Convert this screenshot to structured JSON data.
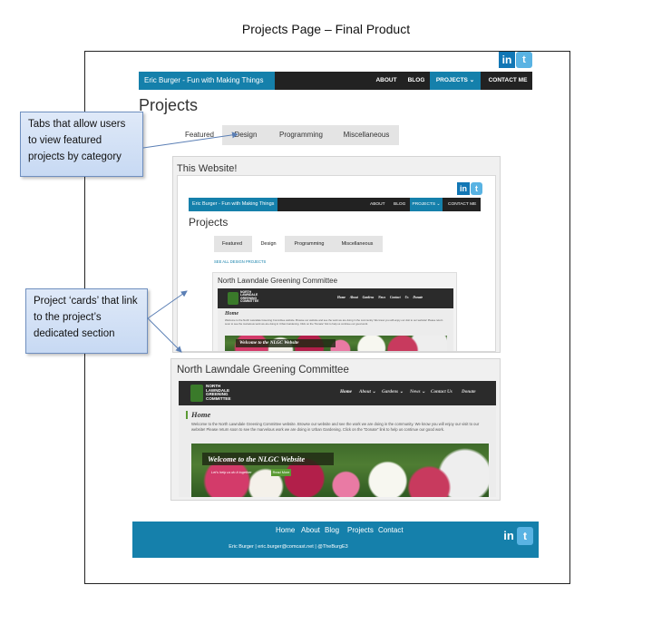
{
  "doc_title": "Projects Page – Final Product",
  "site": {
    "brand": "Eric Burger - Fun with Making Things",
    "nav": [
      "ABOUT",
      "BLOG",
      "PROJECTS",
      "CONTACT ME"
    ],
    "nav_active": "PROJECTS",
    "page_heading": "Projects",
    "tabs": [
      "Featured",
      "Design",
      "Programming",
      "Miscellaneous"
    ],
    "social": {
      "linkedin": "in",
      "twitter": "t"
    }
  },
  "card1": {
    "title": "This Website!",
    "inner": {
      "brand": "Eric Burger - Fun with Making Things",
      "nav": [
        "ABOUT",
        "BLOG",
        "PROJECTS ⌄",
        "CONTACT ME"
      ],
      "heading": "Projects",
      "tabs": [
        "Featured",
        "Design",
        "Programming",
        "Miscellaneous"
      ],
      "see_all": "SEE ALL DESIGN PROJECTS",
      "subcard_title": "North Lawndale Greening Committee"
    }
  },
  "card2": {
    "title": "North Lawndale Greening Committee"
  },
  "nlgc": {
    "logo_lines": [
      "NORTH",
      "LAWNDALE",
      "GREENING",
      "COMMITTEE"
    ],
    "nav": [
      "Home",
      "About ⌄",
      "Gardens ⌄",
      "News ⌄",
      "Contact Us",
      "Donate"
    ],
    "home": "Home",
    "intro": "Welcome to the North Lawndale Greening Committee website. Browse our website and see the work we are doing in the community. We know you will enjoy our visit to our website! Please return soon to see the marvelous work we are doing in Urban Gardening. Click on the \"Donate\" link to help us continue our good work.",
    "welcome": "Welcome to the NLGC Website",
    "welcome_sub": "Let’s help us do it together",
    "welcome_btn": "Read More"
  },
  "callouts": {
    "tabs": "Tabs that allow users to view featured projects by category",
    "cards": "Project ‘cards’ that link to the project’s dedicated section"
  },
  "footer": {
    "links": [
      "Home",
      "About",
      "Blog",
      "Projects",
      "Contact"
    ],
    "contact": "Eric Burger | eric.burger@comcast.net | @TheBurgE3"
  },
  "colors": {
    "accent": "#1580ab",
    "nav_dark": "#222222",
    "callout": "#c7d9f3"
  }
}
